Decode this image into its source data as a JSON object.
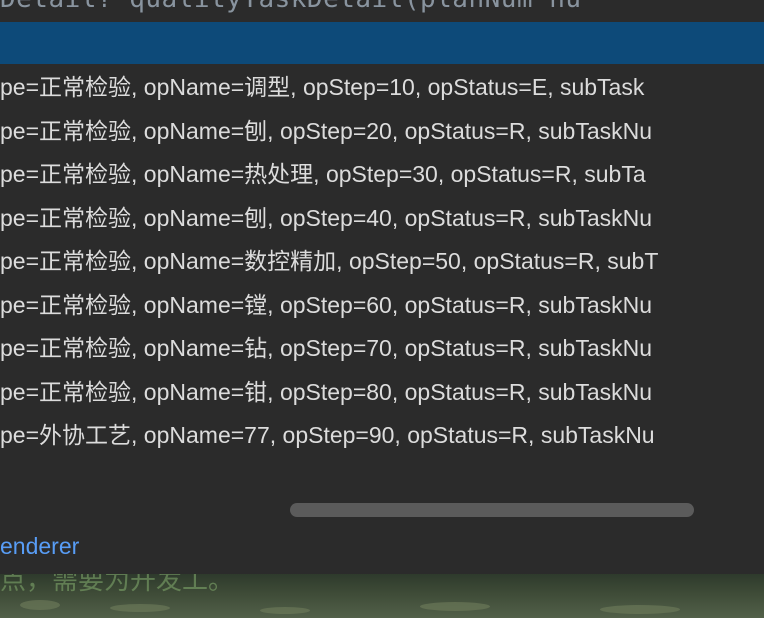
{
  "editor": {
    "top_code": "Detail? qualityTaskDetail(planNum nu"
  },
  "popup": {
    "rows": [
      "pe=正常检验, opName=调型, opStep=10, opStatus=E, subTask",
      "pe=正常检验, opName=刨, opStep=20, opStatus=R, subTaskNu",
      "pe=正常检验, opName=热处理, opStep=30, opStatus=R, subTa",
      "pe=正常检验, opName=刨, opStep=40, opStatus=R, subTaskNu",
      "pe=正常检验, opName=数控精加, opStep=50, opStatus=R, subT",
      "pe=正常检验, opName=镗, opStep=60, opStatus=R, subTaskNu",
      "pe=正常检验, opName=钻, opStep=70, opStatus=R, subTaskNu",
      "pe=正常检验, opName=钳, opStep=80, opStatus=R, subTaskNu",
      "pe=外协工艺, opName=77, opStep=90, opStatus=R, subTaskNu"
    ],
    "renderer_link": "enderer"
  },
  "below": {
    "faint_text": "点，需要为开发工。"
  },
  "colors": {
    "selection": "#0d4a79",
    "popup_bg": "#2b2b2b",
    "link": "#589df6",
    "text": "#dcdcdc"
  }
}
